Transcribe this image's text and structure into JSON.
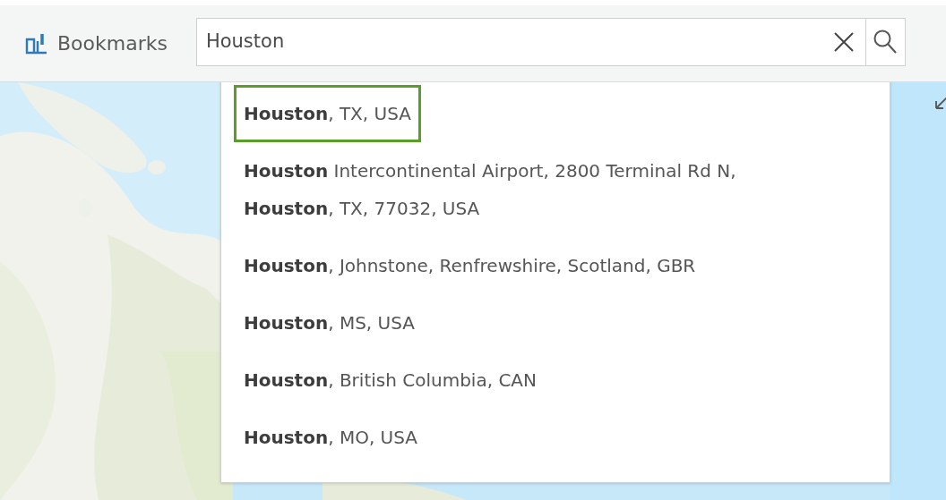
{
  "toolbar": {
    "bookmarks": {
      "label": "Bookmarks"
    }
  },
  "search": {
    "value": "Houston"
  },
  "suggestions": [
    {
      "text": "**Houston**, TX, USA",
      "selected": true
    },
    {
      "text": "**Houston** Intercontinental Airport, 2800 Terminal Rd N, **Houston**, TX, 77032, USA",
      "selected": false
    },
    {
      "text": "**Houston**, Johnstone, Renfrewshire, Scotland, GBR",
      "selected": false
    },
    {
      "text": "**Houston**, MS, USA",
      "selected": false
    },
    {
      "text": "**Houston**, British Columbia, CAN",
      "selected": false
    },
    {
      "text": "**Houston**, MO, USA",
      "selected": false
    }
  ]
}
